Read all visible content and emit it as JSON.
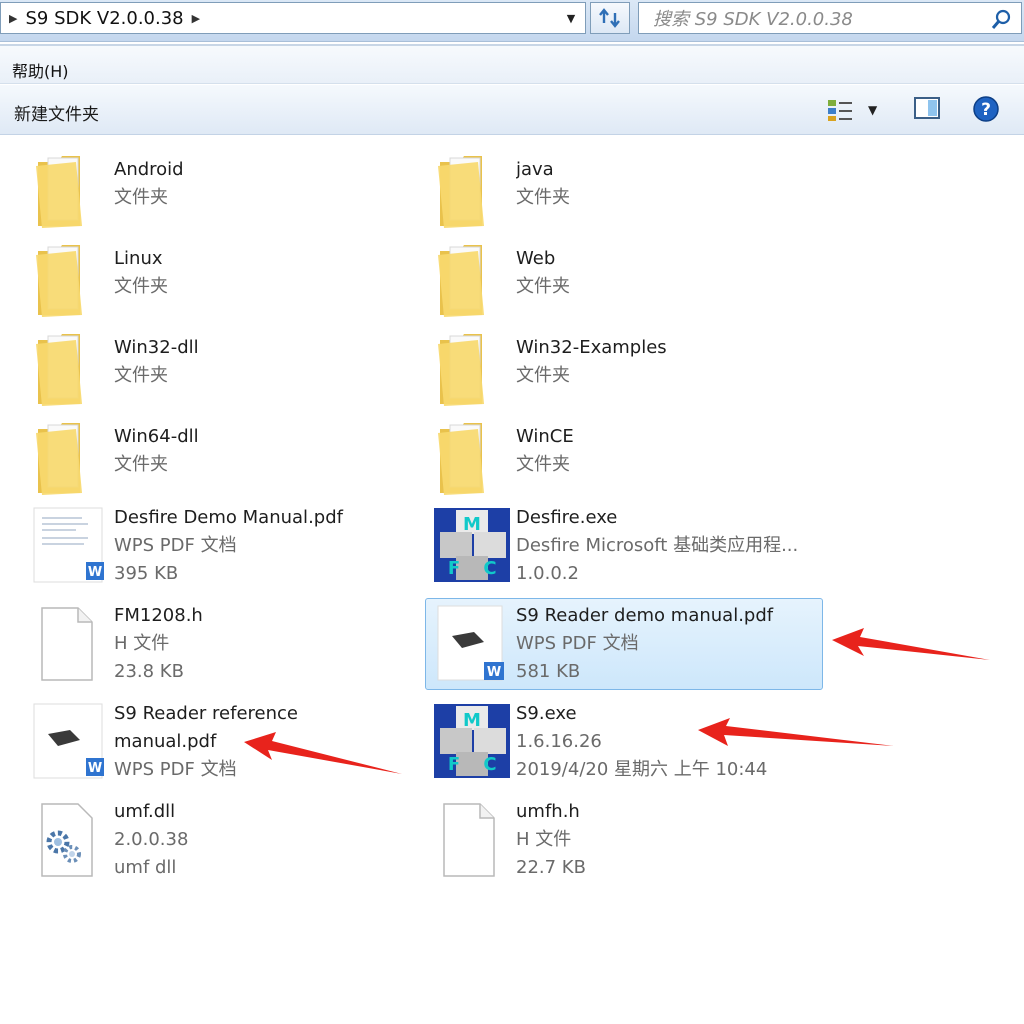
{
  "address": {
    "path": "S9 SDK V2.0.0.38"
  },
  "search": {
    "placeholder": "搜索 S9 SDK V2.0.0.38"
  },
  "menu": {
    "help": "帮助(H)"
  },
  "toolbar": {
    "new_folder": "新建文件夹"
  },
  "icons": {
    "folder": "folder-icon",
    "pdf": "pdf-document-icon",
    "exe": "mfc-application-icon",
    "header": "blank-file-icon",
    "dll": "dll-gear-icon"
  },
  "colors": {
    "selection_bg": "#cde7fb",
    "selection_border": "#7db7e8",
    "arrow_red": "#e8231c",
    "folder_yellow": "#f5d66b"
  },
  "items": [
    {
      "name": "Android",
      "line2": "文件夹",
      "line3": "",
      "type": "folder"
    },
    {
      "name": "java",
      "line2": "文件夹",
      "line3": "",
      "type": "folder"
    },
    {
      "name": "Linux",
      "line2": "文件夹",
      "line3": "",
      "type": "folder"
    },
    {
      "name": "Web",
      "line2": "文件夹",
      "line3": "",
      "type": "folder"
    },
    {
      "name": "Win32-dll",
      "line2": "文件夹",
      "line3": "",
      "type": "folder"
    },
    {
      "name": "Win32-Examples",
      "line2": "文件夹",
      "line3": "",
      "type": "folder"
    },
    {
      "name": "Win64-dll",
      "line2": "文件夹",
      "line3": "",
      "type": "folder"
    },
    {
      "name": "WinCE",
      "line2": "文件夹",
      "line3": "",
      "type": "folder"
    },
    {
      "name": "Desfire Demo Manual.pdf",
      "line2": "WPS PDF 文档",
      "line3": "395 KB",
      "type": "pdf"
    },
    {
      "name": "Desfire.exe",
      "line2": "Desfire Microsoft 基础类应用程...",
      "line3": "1.0.0.2",
      "type": "exe"
    },
    {
      "name": "FM1208.h",
      "line2": "H 文件",
      "line3": "23.8 KB",
      "type": "header"
    },
    {
      "name": "S9 Reader demo manual.pdf",
      "line2": "WPS PDF 文档",
      "line3": "581 KB",
      "type": "pdf",
      "selected": true
    },
    {
      "name": "S9 Reader reference",
      "name2": "manual.pdf",
      "line2": "WPS PDF 文档",
      "line3": "",
      "type": "pdf"
    },
    {
      "name": "S9.exe",
      "line2": "1.6.16.26",
      "line3": "2019/4/20 星期六 上午 10:44",
      "type": "exe"
    },
    {
      "name": "umf.dll",
      "line2": "2.0.0.38",
      "line3": "umf dll",
      "type": "dll"
    },
    {
      "name": "umfh.h",
      "line2": "H 文件",
      "line3": "22.7 KB",
      "type": "header"
    }
  ]
}
